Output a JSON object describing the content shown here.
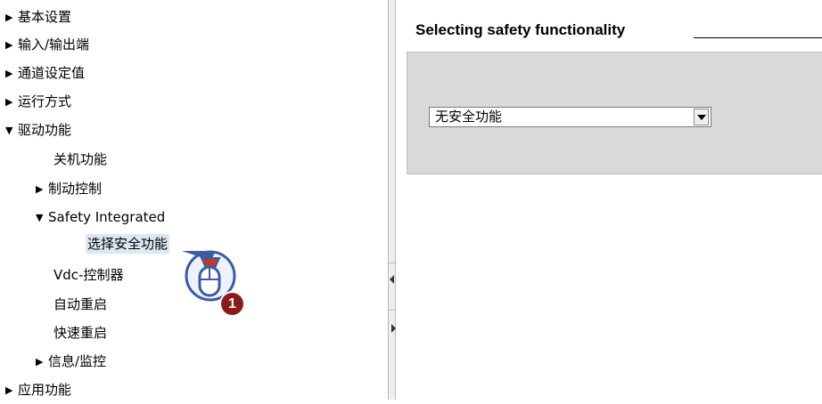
{
  "tree": {
    "items": [
      {
        "label": "基本设置",
        "expander": "▶"
      },
      {
        "label": "输入/输出端",
        "expander": "▶"
      },
      {
        "label": "通道设定值",
        "expander": "▶"
      },
      {
        "label": "运行方式",
        "expander": "▶"
      },
      {
        "label": "驱动功能",
        "expander": "▼"
      },
      {
        "label": "关机功能",
        "expander": ""
      },
      {
        "label": "制动控制",
        "expander": "▶"
      },
      {
        "label": "Safety Integrated",
        "expander": "▼"
      },
      {
        "label": "选择安全功能",
        "expander": "",
        "selected": true
      },
      {
        "label": "Vdc-控制器",
        "expander": ""
      },
      {
        "label": "自动重启",
        "expander": ""
      },
      {
        "label": "快速重启",
        "expander": ""
      },
      {
        "label": "信息/监控",
        "expander": "▶"
      },
      {
        "label": "应用功能",
        "expander": "▶"
      }
    ]
  },
  "main": {
    "heading": "Selecting safety functionality",
    "dropdown_value": "无安全功能"
  },
  "callout": {
    "badge": "1",
    "icon": "mouse-click-icon"
  },
  "colors": {
    "panel_bg": "#d9d9d9",
    "selection_bg": "#dbe7f2",
    "badge": "#8b1a1a",
    "mouse_outline": "#3b5ba5"
  }
}
